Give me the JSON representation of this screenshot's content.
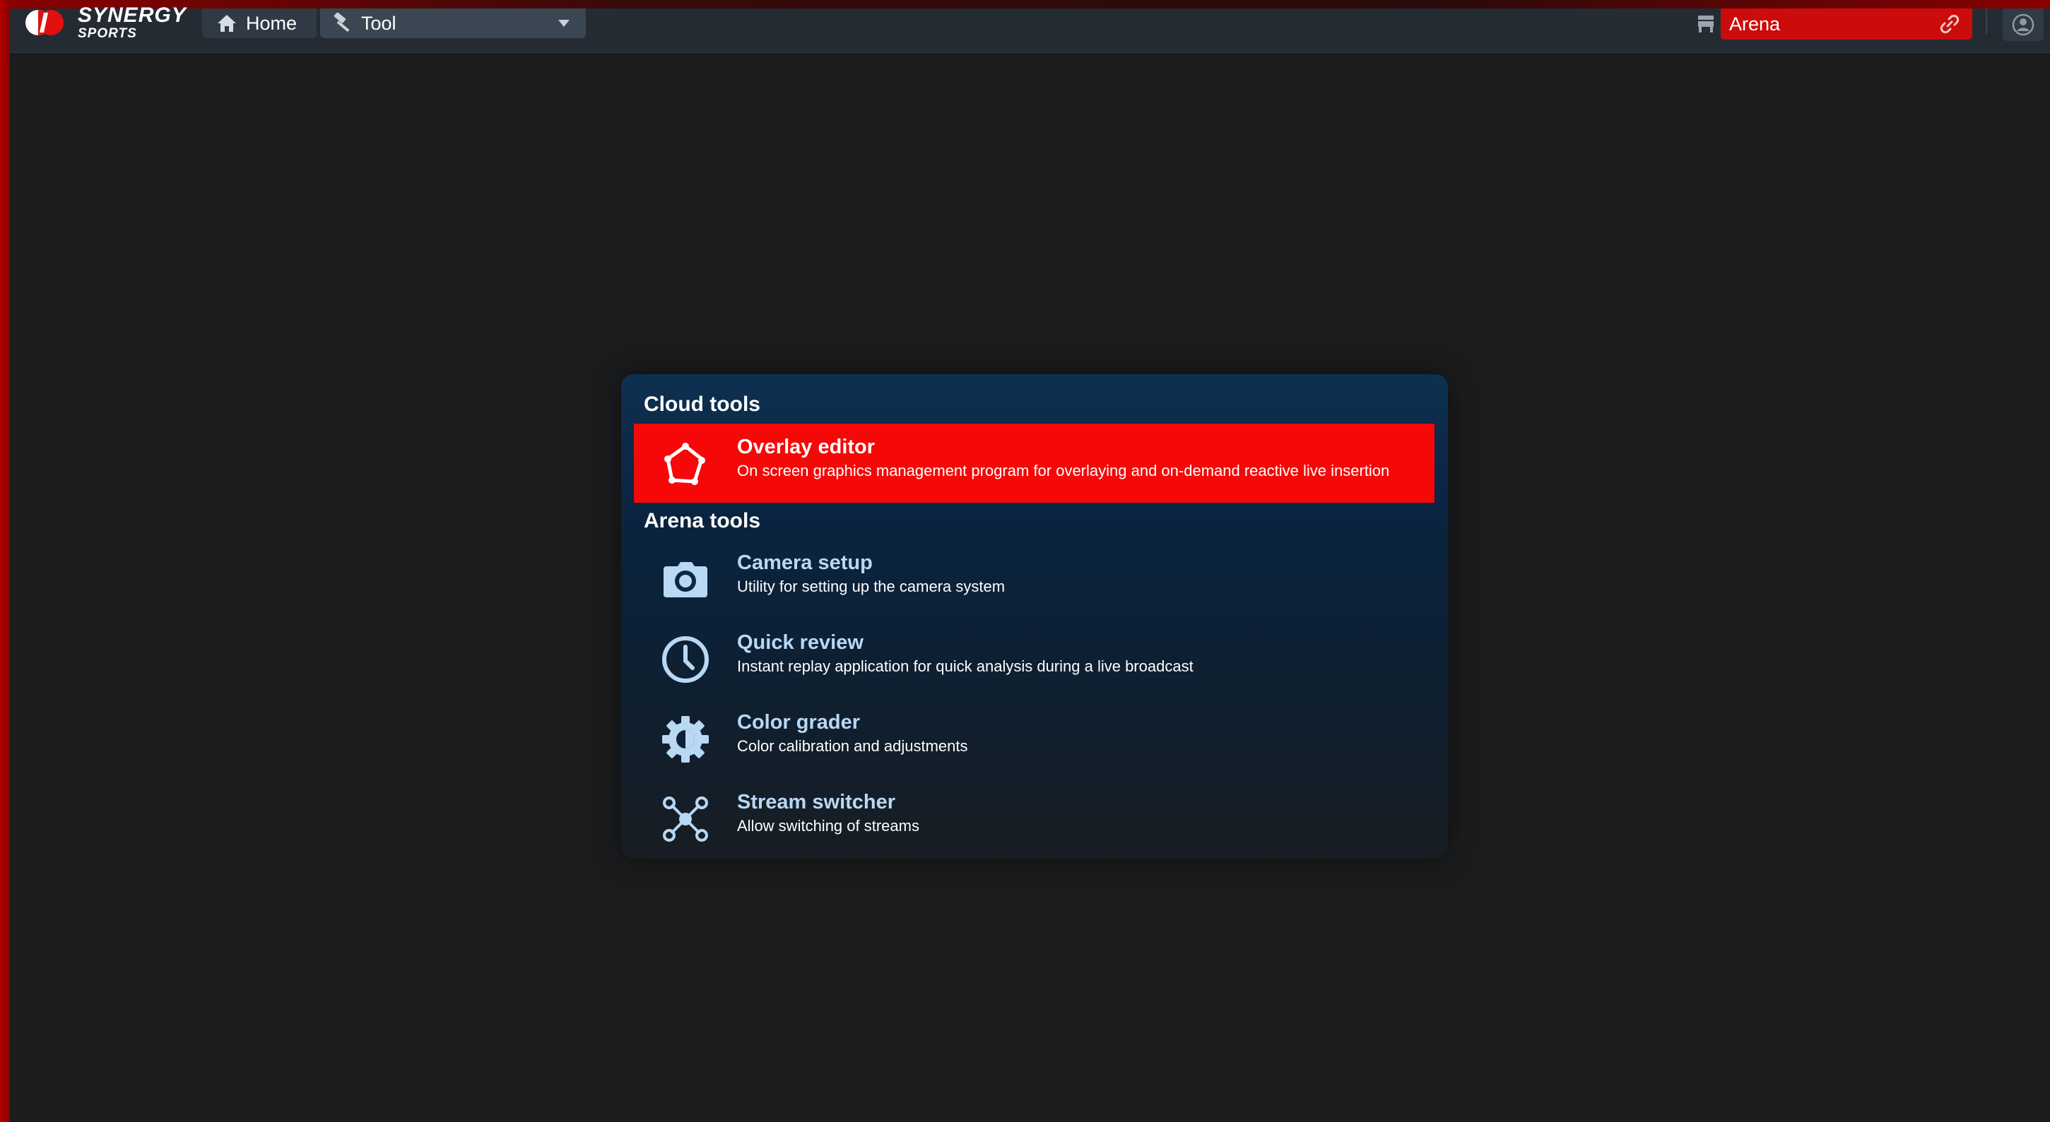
{
  "colors": {
    "background": "#1b1c1e",
    "topbar": "#242b33",
    "accent_red": "#f60808",
    "arena_red": "#cc0c0c",
    "item_title": "#b8d8f4"
  },
  "header": {
    "logo": {
      "line1": "SYNERGY",
      "line2": "SPORTS",
      "icon": "synergy-logo-icon"
    },
    "home": {
      "label": "Home",
      "icon": "home-icon"
    },
    "tool_select": {
      "label": "Tool",
      "icon": "hammer-icon",
      "caret_icon": "chevron-down-icon"
    },
    "seat_icon": "seat-icon",
    "arena_select": {
      "label": "Arena",
      "icon": "link-icon"
    },
    "user_icon": "user-icon"
  },
  "menu": {
    "sections": [
      {
        "title": "Cloud tools",
        "items": [
          {
            "title": "Overlay editor",
            "description": "On screen graphics management program for overlaying and on-demand reactive live insertion",
            "icon": "polygon-icon",
            "active": true
          }
        ]
      },
      {
        "title": "Arena tools",
        "items": [
          {
            "title": "Camera setup",
            "description": "Utility for setting up the camera system",
            "icon": "camera-icon",
            "active": false
          },
          {
            "title": "Quick review",
            "description": "Instant replay application for quick analysis during a live broadcast",
            "icon": "clock-icon",
            "active": false
          },
          {
            "title": "Color grader",
            "description": "Color calibration and adjustments",
            "icon": "color-gear-icon",
            "active": false
          },
          {
            "title": "Stream switcher",
            "description": "Allow switching of streams",
            "icon": "network-icon",
            "active": false
          }
        ]
      }
    ]
  }
}
